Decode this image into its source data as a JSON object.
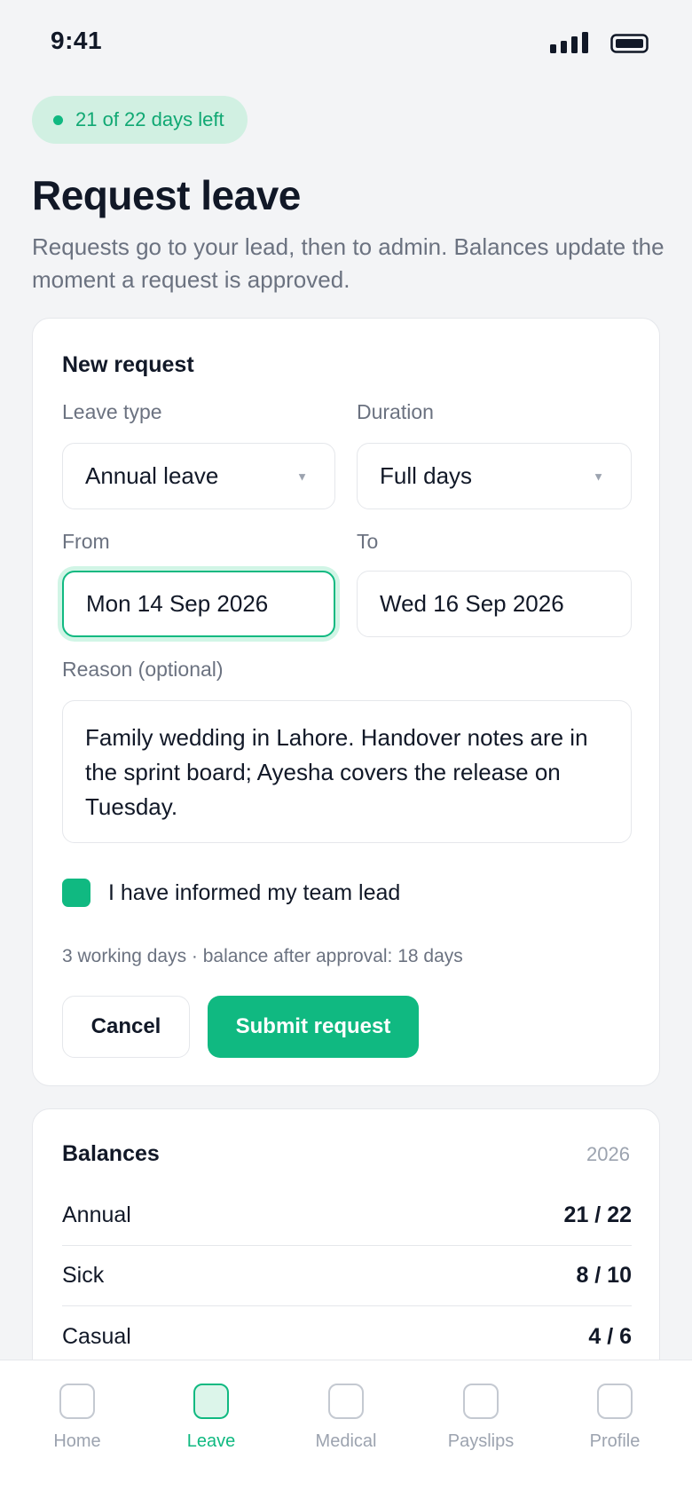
{
  "status_bar": {
    "time": "9:41"
  },
  "pill": {
    "text": "21 of 22 days left"
  },
  "page": {
    "title": "Request leave",
    "subtitle": "Requests go to your lead, then to admin. Balances update the moment a request is approved."
  },
  "request_form": {
    "heading": "New request",
    "leave_type": {
      "label": "Leave type",
      "value": "Annual leave"
    },
    "duration": {
      "label": "Duration",
      "value": "Full days"
    },
    "from": {
      "label": "From",
      "value": "Mon 14 Sep 2026"
    },
    "to": {
      "label": "To",
      "value": "Wed 16 Sep 2026"
    },
    "reason": {
      "label": "Reason (optional)",
      "value": "Family wedding in Lahore. Handover notes are in the sprint board; Ayesha covers the release on Tuesday."
    },
    "checkbox": {
      "label": "I have informed my team lead",
      "checked": true
    },
    "summary": "3 working days · balance after approval: 18 days",
    "cancel_label": "Cancel",
    "submit_label": "Submit request"
  },
  "balances": {
    "heading": "Balances",
    "year": "2026",
    "rows": [
      {
        "name": "Annual",
        "value": "21 / 22"
      },
      {
        "name": "Sick",
        "value": "8 / 10"
      },
      {
        "name": "Casual",
        "value": "4 / 6"
      }
    ]
  },
  "bottom_nav": {
    "items": [
      {
        "label": "Home",
        "icon": "home-icon"
      },
      {
        "label": "Leave",
        "icon": "leave-icon",
        "active": true
      },
      {
        "label": "Medical",
        "icon": "medical-icon"
      },
      {
        "label": "Payslips",
        "icon": "payslips-icon"
      },
      {
        "label": "Profile",
        "icon": "profile-icon"
      }
    ]
  },
  "colors": {
    "accent": "#10b981",
    "accent_light": "#d1f0e2",
    "background": "#f3f4f6",
    "text_primary": "#111827",
    "text_muted": "#6b7280"
  }
}
